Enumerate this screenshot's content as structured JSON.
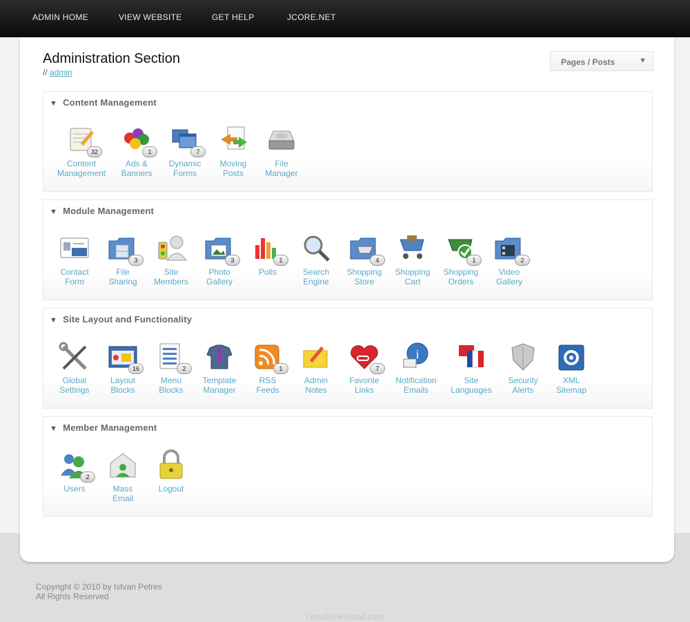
{
  "nav": [
    "ADMIN HOME",
    "VIEW WEBSITE",
    "GET HELP",
    "JCORE.NET"
  ],
  "header": {
    "title": "Administration Section",
    "breadcrumb_prefix": "//",
    "breadcrumb_link": "admin"
  },
  "dropdown": {
    "label": "Pages / Posts"
  },
  "sections": [
    {
      "title": "Content Management",
      "items": [
        {
          "label": "Content\nManagement",
          "icon": "notepad-pencil-icon",
          "badge": "32"
        },
        {
          "label": "Ads &\nBanners",
          "icon": "colored-balls-icon",
          "badge": "1"
        },
        {
          "label": "Dynamic\nForms",
          "icon": "blue-windows-icon",
          "badge": "7"
        },
        {
          "label": "Moving\nPosts",
          "icon": "document-arrows-icon",
          "badge": ""
        },
        {
          "label": "File\nManager",
          "icon": "hard-drive-icon",
          "badge": ""
        }
      ]
    },
    {
      "title": "Module Management",
      "items": [
        {
          "label": "Contact\nForm",
          "icon": "id-card-icon",
          "badge": ""
        },
        {
          "label": "File\nSharing",
          "icon": "folder-cabinet-icon",
          "badge": "3"
        },
        {
          "label": "Site\nMembers",
          "icon": "user-traffic-icon",
          "badge": ""
        },
        {
          "label": "Photo\nGallery",
          "icon": "folder-photo-icon",
          "badge": "3"
        },
        {
          "label": "Polls",
          "icon": "bar-chart-icon",
          "badge": "1"
        },
        {
          "label": "Search\nEngine",
          "icon": "magnifier-icon",
          "badge": ""
        },
        {
          "label": "Shopping\nStore",
          "icon": "folder-cart-icon",
          "badge": "4"
        },
        {
          "label": "Shopping\nCart",
          "icon": "shopping-cart-icon",
          "badge": ""
        },
        {
          "label": "Shopping\nOrders",
          "icon": "cart-check-icon",
          "badge": "1"
        },
        {
          "label": "Video\nGallery",
          "icon": "folder-film-icon",
          "badge": "2"
        }
      ]
    },
    {
      "title": "Site Layout and Functionality",
      "items": [
        {
          "label": "Global\nSettings",
          "icon": "wrench-screwdriver-icon",
          "badge": ""
        },
        {
          "label": "Layout\nBlocks",
          "icon": "layout-window-icon",
          "badge": "16"
        },
        {
          "label": "Menu\nBlocks",
          "icon": "menu-list-icon",
          "badge": "2"
        },
        {
          "label": "Template\nManager",
          "icon": "shirt-tie-icon",
          "badge": ""
        },
        {
          "label": "RSS\nFeeds",
          "icon": "rss-icon",
          "badge": "1"
        },
        {
          "label": "Admin\nNotes",
          "icon": "sticky-note-pencil-icon",
          "badge": ""
        },
        {
          "label": "Favorite\nLinks",
          "icon": "heart-link-icon",
          "badge": "7"
        },
        {
          "label": "Notification\nEmails",
          "icon": "info-mail-icon",
          "badge": ""
        },
        {
          "label": "Site\nLanguages",
          "icon": "flags-icon",
          "badge": ""
        },
        {
          "label": "Security\nAlerts",
          "icon": "shield-icon",
          "badge": ""
        },
        {
          "label": "XML\nSitemap",
          "icon": "sitemap-icon",
          "badge": ""
        }
      ]
    },
    {
      "title": "Member Management",
      "items": [
        {
          "label": "Users",
          "icon": "users-icon",
          "badge": "2"
        },
        {
          "label": "Mass\nEmail",
          "icon": "mass-email-icon",
          "badge": ""
        },
        {
          "label": "Logout",
          "icon": "padlock-icon",
          "badge": ""
        }
      ]
    }
  ],
  "footer": {
    "copyright": "Copyright © 2010 by Istvan Petres",
    "rights": "All Rights Reserved",
    "watermark": "GearDownload.com"
  }
}
